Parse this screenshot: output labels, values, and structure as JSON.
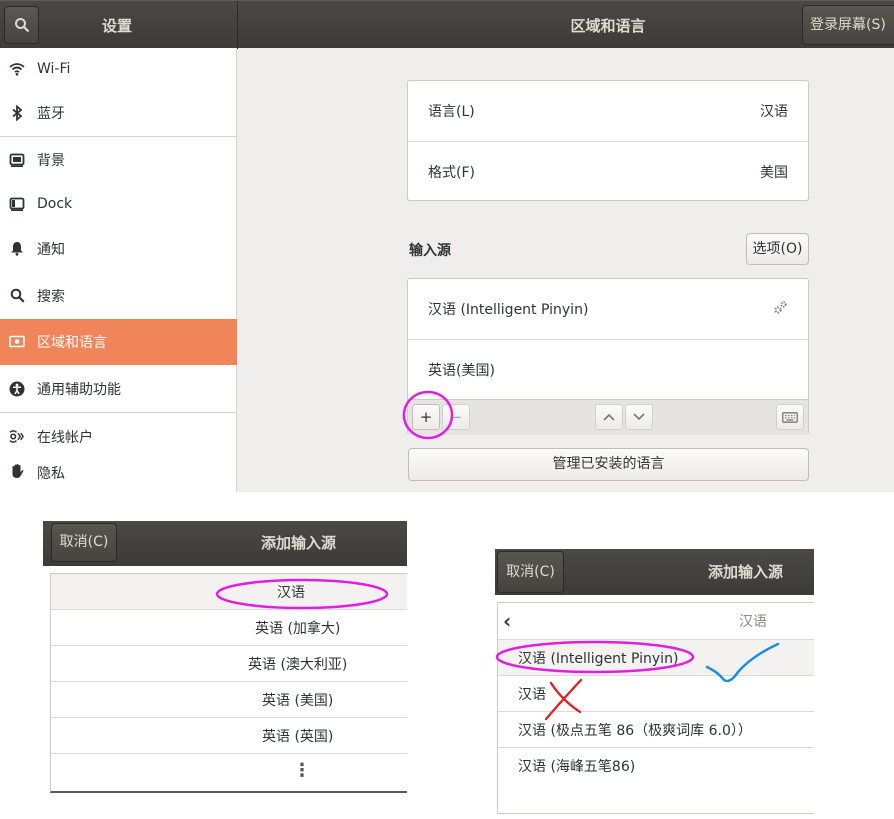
{
  "main": {
    "header": {
      "sidebar_title": "设置",
      "title": "区域和语言",
      "right_button": "登录屏幕(S)"
    },
    "sidebar": {
      "items": [
        {
          "label": "Wi-Fi",
          "icon": "wifi-icon"
        },
        {
          "label": "蓝牙",
          "icon": "bluetooth-icon"
        },
        {
          "label": "背景",
          "icon": "background-icon"
        },
        {
          "label": "Dock",
          "icon": "dock-icon"
        },
        {
          "label": "通知",
          "icon": "bell-icon"
        },
        {
          "label": "搜索",
          "icon": "search-icon"
        },
        {
          "label": "区域和语言",
          "icon": "region-icon",
          "active": true
        },
        {
          "label": "通用辅助功能",
          "icon": "accessibility-icon"
        },
        {
          "label": "在线帐户",
          "icon": "online-accounts-icon"
        },
        {
          "label": "隐私",
          "icon": "hand-icon"
        }
      ]
    },
    "language_row": {
      "label": "语言(L)",
      "value": "汉语"
    },
    "format_row": {
      "label": "格式(F)",
      "value": "美国"
    },
    "input_sources": {
      "title": "输入源",
      "options_button": "选项(O)",
      "items": [
        "汉语 (Intelligent Pinyin)",
        "英语(美国)"
      ],
      "add_symbol": "+",
      "remove_symbol": "−"
    },
    "manage_button": "管理已安装的语言"
  },
  "dialog1": {
    "cancel": "取消(C)",
    "title": "添加输入源",
    "items": [
      "汉语",
      "英语 (加拿大)",
      "英语 (澳大利亚)",
      "英语 (美国)",
      "英语 (英国)"
    ],
    "more_symbol": "⋮"
  },
  "dialog2": {
    "cancel": "取消(C)",
    "title": "添加输入源",
    "back_symbol": "‹",
    "header_label": "汉语",
    "items": [
      "汉语 (Intelligent Pinyin)",
      "汉语",
      "汉语 (极点五笔 86（极爽词库 6.0））",
      "汉语 (海峰五笔86)"
    ]
  },
  "colors": {
    "accent": "#f0855a",
    "headerbar": "#3c3b37",
    "annotation_circle": "#e020e0",
    "annotation_check": "#1a8fe0",
    "annotation_cross": "#e02020"
  }
}
